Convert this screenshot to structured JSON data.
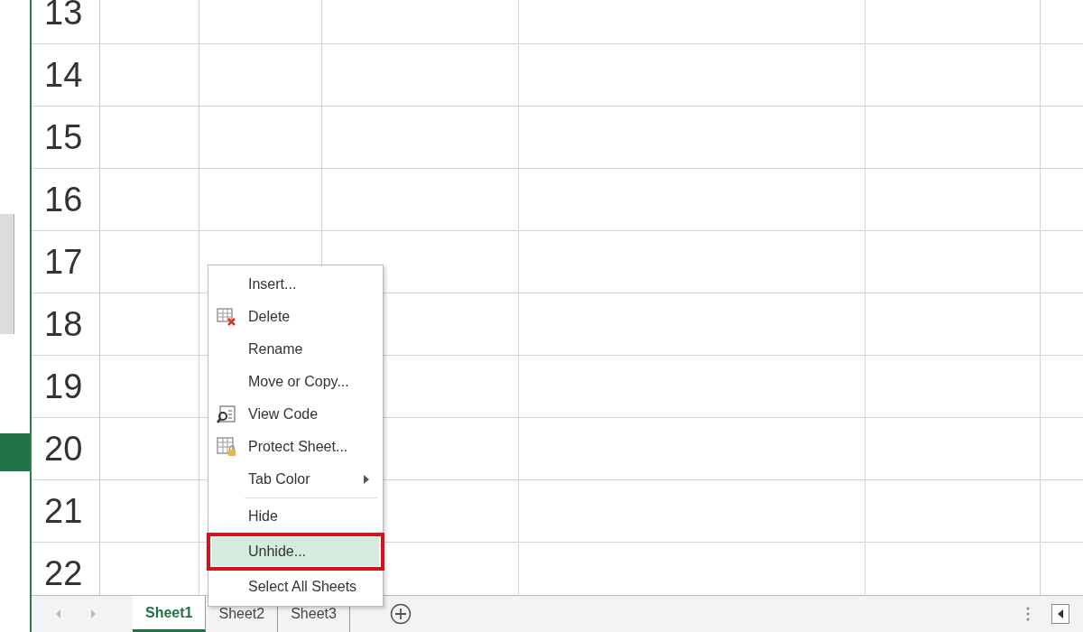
{
  "row_headers": [
    "13",
    "14",
    "15",
    "16",
    "17",
    "18",
    "19",
    "20",
    "21",
    "22"
  ],
  "context_menu": {
    "items": [
      {
        "kind": "item",
        "label": "Insert...",
        "selected": false
      },
      {
        "kind": "item",
        "label": "Delete",
        "selected": false
      },
      {
        "kind": "item",
        "label": "Rename",
        "selected": false
      },
      {
        "kind": "item",
        "label": "Move or Copy...",
        "selected": false
      },
      {
        "kind": "item",
        "label": "View Code",
        "selected": false
      },
      {
        "kind": "item",
        "label": "Protect Sheet...",
        "selected": false
      },
      {
        "kind": "submenu",
        "label": "Tab Color",
        "selected": false
      },
      {
        "kind": "separator"
      },
      {
        "kind": "item",
        "label": "Hide",
        "selected": false
      },
      {
        "kind": "item",
        "label": "Unhide...",
        "selected": true,
        "highlighted": true
      },
      {
        "kind": "item",
        "label": "Select All Sheets",
        "selected": false
      }
    ]
  },
  "sheet_tabs": [
    {
      "label": "Sheet1",
      "selected": true
    },
    {
      "label": "Sheet2",
      "selected": false
    },
    {
      "label": "Sheet3",
      "selected": false
    }
  ]
}
